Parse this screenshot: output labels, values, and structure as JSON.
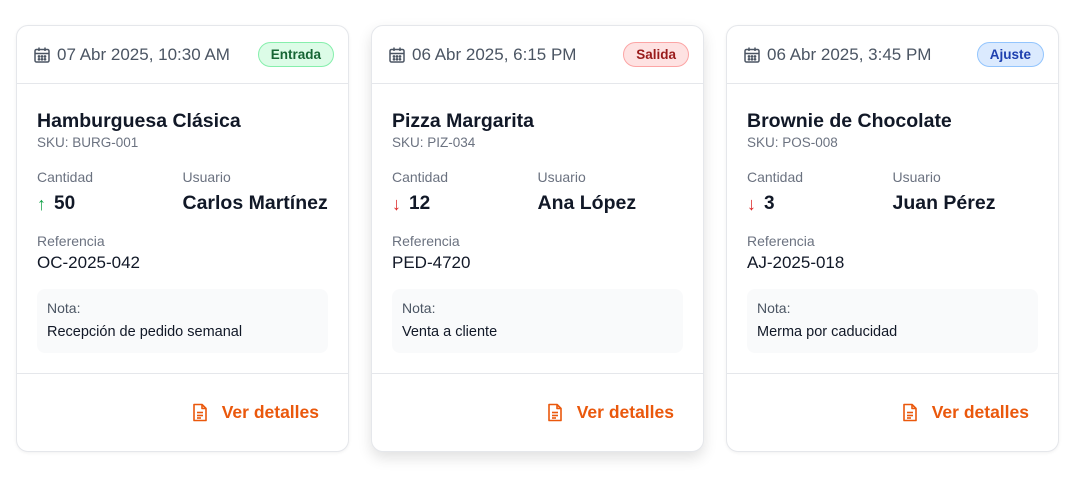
{
  "cards": [
    {
      "date": "07 Abr 2025, 10:30 AM",
      "badge": "Entrada",
      "product": "Hamburguesa Clásica",
      "sku": "SKU: BURG-001",
      "quantity_label": "Cantidad",
      "quantity": "50",
      "direction": "up",
      "user_label": "Usuario",
      "user": "Carlos Martínez",
      "reference_label": "Referencia",
      "reference": "OC-2025-042",
      "note_label": "Nota:",
      "note": "Recepción de pedido semanal",
      "details_label": "Ver detalles"
    },
    {
      "date": "06 Abr 2025, 6:15 PM",
      "badge": "Salida",
      "product": "Pizza Margarita",
      "sku": "SKU: PIZ-034",
      "quantity_label": "Cantidad",
      "quantity": "12",
      "direction": "down",
      "user_label": "Usuario",
      "user": "Ana López",
      "reference_label": "Referencia",
      "reference": "PED-4720",
      "note_label": "Nota:",
      "note": "Venta a cliente",
      "details_label": "Ver detalles"
    },
    {
      "date": "06 Abr 2025, 3:45 PM",
      "badge": "Ajuste",
      "product": "Brownie de Chocolate",
      "sku": "SKU: POS-008",
      "quantity_label": "Cantidad",
      "quantity": "3",
      "direction": "down",
      "user_label": "Usuario",
      "user": "Juan Pérez",
      "reference_label": "Referencia",
      "reference": "AJ-2025-018",
      "note_label": "Nota:",
      "note": "Merma por caducidad",
      "details_label": "Ver detalles"
    }
  ],
  "icons": {
    "date": "calendar-icon",
    "up": "arrow-up-icon",
    "down": "arrow-down-icon",
    "details": "document-icon"
  },
  "colors": {
    "accent": "#ea580c",
    "entrada": "#166534",
    "salida": "#991b1b",
    "ajuste": "#1e40af",
    "up": "#16a34a",
    "down": "#dc2626"
  }
}
